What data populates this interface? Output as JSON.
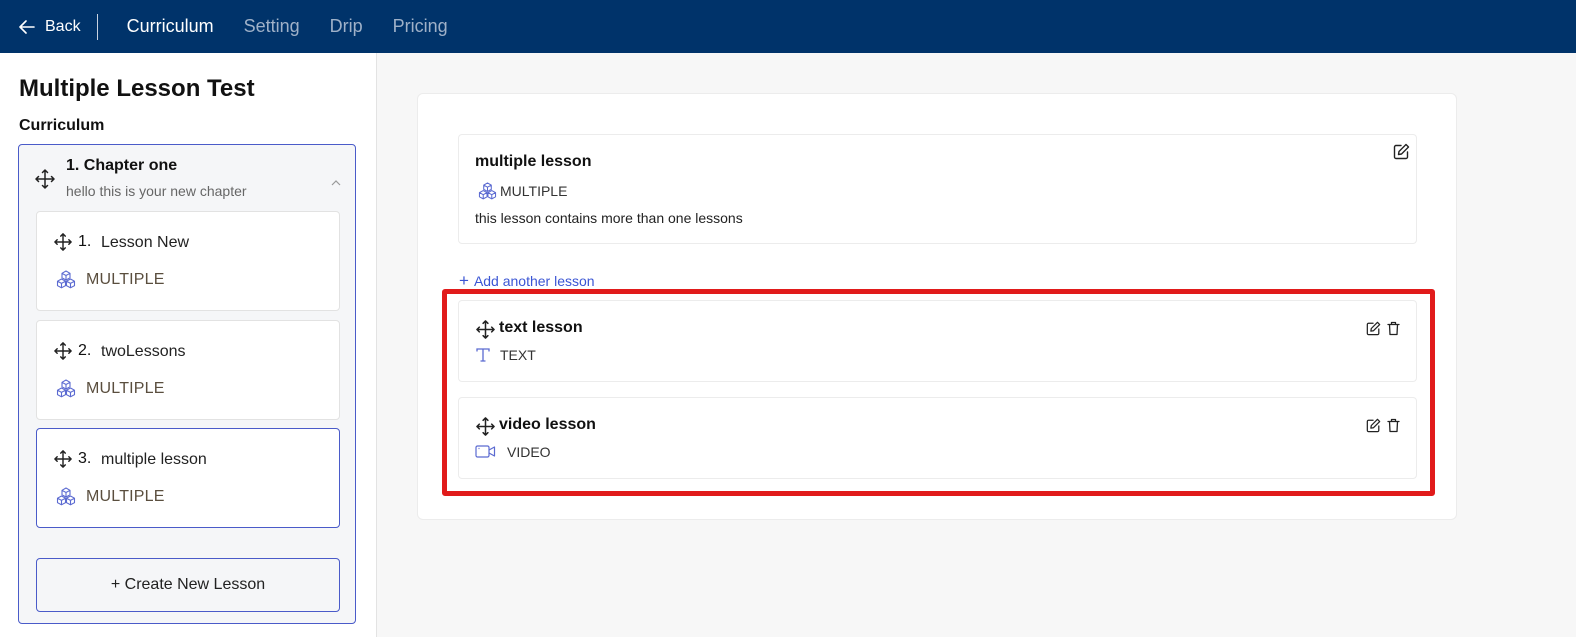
{
  "nav": {
    "back_label": "Back",
    "tabs": [
      {
        "label": "Curriculum",
        "active": true
      },
      {
        "label": "Setting",
        "active": false
      },
      {
        "label": "Drip",
        "active": false
      },
      {
        "label": "Pricing",
        "active": false
      }
    ]
  },
  "sidebar": {
    "course_title": "Multiple Lesson Test",
    "section_label": "Curriculum",
    "chapter": {
      "title": "1. Chapter one",
      "subtitle": "hello this is your new chapter",
      "lessons": [
        {
          "num": "1.",
          "title": "Lesson New",
          "type": "MULTIPLE"
        },
        {
          "num": "2.",
          "title": "twoLessons",
          "type": "MULTIPLE"
        },
        {
          "num": "3.",
          "title": "multiple lesson",
          "type": "MULTIPLE"
        }
      ]
    },
    "create_lesson_label": "+ Create New Lesson"
  },
  "main": {
    "parent_lesson": {
      "title": "multiple lesson",
      "type": "MULTIPLE",
      "description": "this lesson contains more than one lessons"
    },
    "add_lesson_label": "Add another lesson",
    "sub_lessons": [
      {
        "title": "text lesson",
        "type": "TEXT",
        "icon": "text-type-icon"
      },
      {
        "title": "video lesson",
        "type": "VIDEO",
        "icon": "video-type-icon"
      }
    ]
  },
  "colors": {
    "nav_bg": "#00336a",
    "accent": "#4a5bc9",
    "link": "#3a55d4",
    "highlight": "#e11b1b"
  }
}
